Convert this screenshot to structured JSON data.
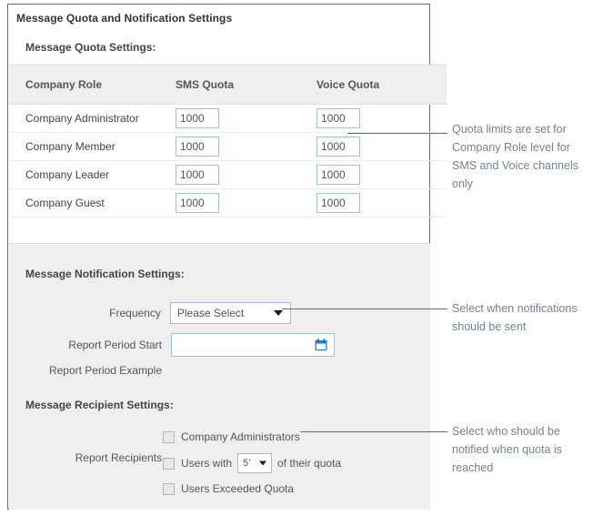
{
  "panel": {
    "title": "Message Quota and Notification Settings"
  },
  "quota_section": {
    "heading": "Message Quota Settings:",
    "columns": [
      "Company Role",
      "SMS Quota",
      "Voice Quota"
    ],
    "rows": [
      {
        "role": "Company Administrator",
        "sms": "1000",
        "voice": "1000"
      },
      {
        "role": "Company Member",
        "sms": "1000",
        "voice": "1000"
      },
      {
        "role": "Company Leader",
        "sms": "1000",
        "voice": "1000"
      },
      {
        "role": "Company Guest",
        "sms": "1000",
        "voice": "1000"
      }
    ]
  },
  "notification_section": {
    "heading": "Message Notification Settings:",
    "frequency_label": "Frequency",
    "frequency_value": "Please Select",
    "report_period_start_label": "Report Period Start",
    "report_period_start_value": "",
    "report_period_example_label": "Report Period Example",
    "calendar_icon": "calendar-icon"
  },
  "recipient_section": {
    "heading": "Message Recipient Settings:",
    "report_recipients_label": "Report Recipients",
    "option_admins": "Company Administrators",
    "option_users_with_prefix": "Users with",
    "percent_value": "5’",
    "option_users_with_suffix": "of their quota",
    "option_exceeded": "Users Exceeded Quota"
  },
  "annotations": {
    "quota": "Quota limits are set for Company Role level for SMS and Voice channels only",
    "frequency": "Select when notifications should be sent",
    "recipients": "Select who should be notified when quota is reached"
  }
}
